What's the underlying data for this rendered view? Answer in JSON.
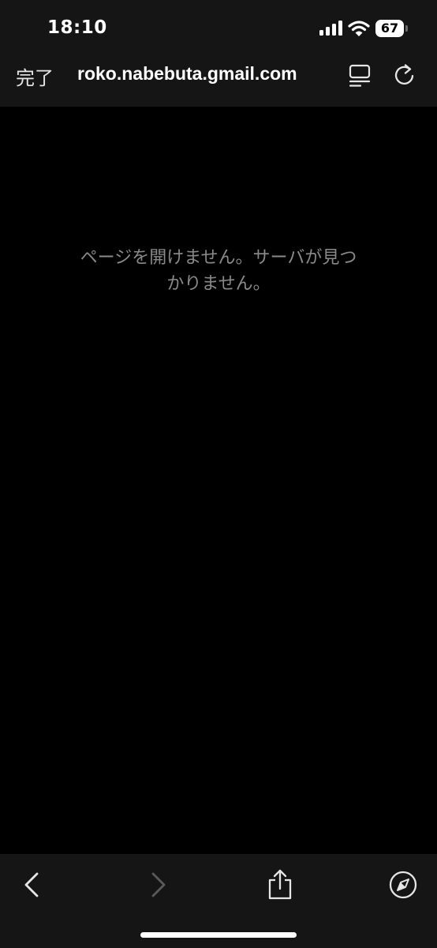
{
  "status_bar": {
    "time": "18:10",
    "battery_level": "67"
  },
  "toolbar": {
    "done_label": "完了",
    "title": "roko.nabebuta.gmail.com"
  },
  "content": {
    "error_line1": "ページを開けません。サーバが見つ",
    "error_line2": "かりません。"
  },
  "icons": {
    "signal": "signal-icon",
    "wifi": "wifi-icon",
    "reader": "reader-mode-icon",
    "reload": "reload-icon",
    "back": "chevron-left-icon",
    "forward": "chevron-right-icon",
    "share": "share-icon",
    "safari": "compass-icon"
  },
  "colors": {
    "bar_background": "#151515",
    "content_background": "#000000",
    "message_text": "#8a8a8a",
    "disabled_icon": "#5a5a5a"
  }
}
